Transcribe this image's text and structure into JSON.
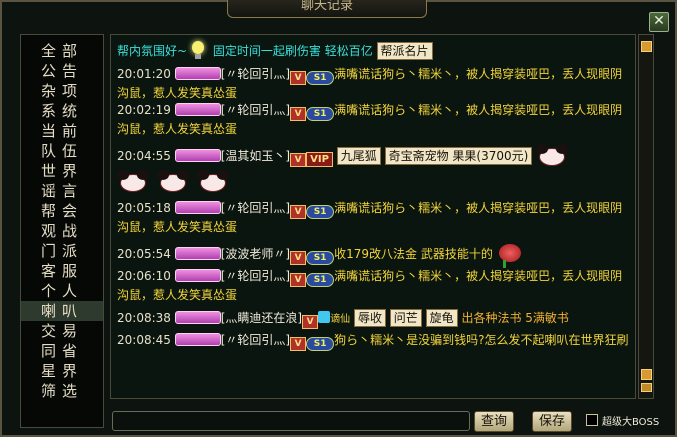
{
  "window": {
    "title": "聊天记录",
    "close": "✕"
  },
  "sidebar": {
    "items": [
      {
        "label": "全部",
        "active": false
      },
      {
        "label": "公告",
        "active": false
      },
      {
        "label": "杂项",
        "active": false
      },
      {
        "label": "系统",
        "active": false
      },
      {
        "label": "当前",
        "active": false
      },
      {
        "label": "队伍",
        "active": false
      },
      {
        "label": "世界",
        "active": false
      },
      {
        "label": "谣言",
        "active": false
      },
      {
        "label": "帮会",
        "active": false
      },
      {
        "label": "观战",
        "active": false
      },
      {
        "label": "门派",
        "active": false
      },
      {
        "label": "客服",
        "active": false
      },
      {
        "label": "个人",
        "active": false
      },
      {
        "label": "喇叭",
        "active": true
      },
      {
        "label": "交易",
        "active": false
      },
      {
        "label": "同省",
        "active": false
      },
      {
        "label": "星界",
        "active": false
      },
      {
        "label": "筛选",
        "active": false
      }
    ]
  },
  "chat": {
    "header": {
      "text1": "帮内氛围好~",
      "text2": " 固定时间一起刷伤害 轻松百亿",
      "tag": "帮派名片"
    },
    "messages": [
      {
        "time": "20:01:20",
        "name": "[〃轮回引灬]",
        "text": "满嘴谎话狗ら丶糯米丶，被人揭穿装哑巴，丢人现眼阴沟鼠，惹人发笑真怂蛋"
      },
      {
        "time": "20:02:19",
        "name": "[〃轮回引灬]",
        "text": "满嘴谎话狗ら丶糯米丶，被人揭穿装哑巴，丢人现眼阴沟鼠，惹人发笑真怂蛋"
      },
      {
        "time": "20:04:55",
        "name": "[温其如玉丶]",
        "vip": "VIP",
        "tags": [
          "九尾狐",
          "奇宝斋宠物 果果(3700元)"
        ]
      },
      {
        "time": "20:05:18",
        "name": "[〃轮回引灬]",
        "text": "满嘴谎话狗ら丶糯米丶，被人揭穿装哑巴，丢人现眼阴沟鼠，惹人发笑真怂蛋"
      },
      {
        "time": "20:05:54",
        "name": "[波波老师〃]",
        "text": "收179改八法金 武器技能十的"
      },
      {
        "time": "20:06:10",
        "name": "[〃轮回引灬]",
        "text": "满嘴谎话狗ら丶糯米丶，被人揭穿装哑巴，丢人现眼阴沟鼠，惹人发笑真怂蛋"
      },
      {
        "time": "20:08:38",
        "name": "[灬瞒迪还在浪]",
        "badge": "谪仙",
        "tags": [
          "辱收",
          "问芒",
          "旋龟"
        ],
        "text": " 出各种法书  5满敏书"
      },
      {
        "time": "20:08:45",
        "name": "[〃轮回引灬]",
        "text": "狗ら丶糯米丶是没骗到钱吗?怎么发不起喇叭在世界狂刷"
      }
    ]
  },
  "footer": {
    "query": "查询",
    "save": "保存",
    "checkbox_label": "超级大BOSS"
  },
  "colors": {
    "cyan": "#39e0d8",
    "yellow": "#f2d43a",
    "orange": "#f2b030"
  }
}
